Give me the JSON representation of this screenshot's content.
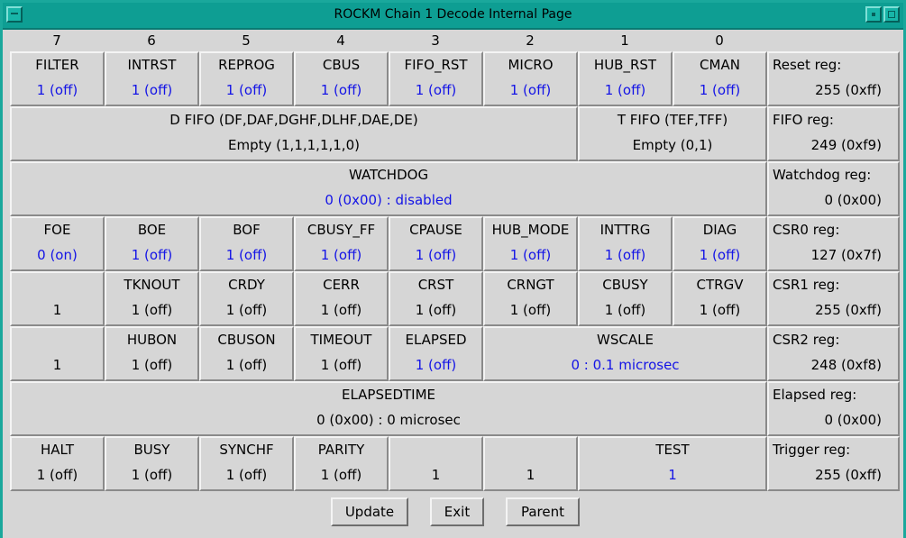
{
  "window": {
    "title": "ROCKM Chain 1 Decode Internal Page"
  },
  "columns": [
    "7",
    "6",
    "5",
    "4",
    "3",
    "2",
    "1",
    "0"
  ],
  "rows": [
    {
      "cells": [
        {
          "label": "FILTER",
          "value": "1 (off)",
          "blue": true
        },
        {
          "label": "INTRST",
          "value": "1 (off)",
          "blue": true
        },
        {
          "label": "REPROG",
          "value": "1 (off)",
          "blue": true
        },
        {
          "label": "CBUS",
          "value": "1 (off)",
          "blue": true
        },
        {
          "label": "FIFO_RST",
          "value": "1 (off)",
          "blue": true
        },
        {
          "label": "MICRO",
          "value": "1 (off)",
          "blue": true
        },
        {
          "label": "HUB_RST",
          "value": "1 (off)",
          "blue": true
        },
        {
          "label": "CMAN",
          "value": "1 (off)",
          "blue": true
        }
      ],
      "reg": {
        "label": "Reset reg:",
        "value": "255 (0xff)"
      }
    },
    {
      "cells": [
        {
          "label": "D FIFO (DF,DAF,DGHF,DLHF,DAE,DE)",
          "value": "Empty (1,1,1,1,1,0)",
          "blue": false,
          "span": 6
        },
        {
          "label": "T FIFO (TEF,TFF)",
          "value": "Empty (0,1)",
          "blue": false,
          "span": 2
        }
      ],
      "reg": {
        "label": "FIFO reg:",
        "value": "249 (0xf9)"
      }
    },
    {
      "cells": [
        {
          "label": "WATCHDOG",
          "value": "0 (0x00) : disabled",
          "blue": true,
          "span": 8
        }
      ],
      "reg": {
        "label": "Watchdog reg:",
        "value": "0 (0x00)"
      }
    },
    {
      "cells": [
        {
          "label": "FOE",
          "value": "0 (on)",
          "blue": true
        },
        {
          "label": "BOE",
          "value": "1 (off)",
          "blue": true
        },
        {
          "label": "BOF",
          "value": "1 (off)",
          "blue": true
        },
        {
          "label": "CBUSY_FF",
          "value": "1 (off)",
          "blue": true
        },
        {
          "label": "CPAUSE",
          "value": "1 (off)",
          "blue": true
        },
        {
          "label": "HUB_MODE",
          "value": "1 (off)",
          "blue": true
        },
        {
          "label": "INTTRG",
          "value": "1 (off)",
          "blue": true
        },
        {
          "label": "DIAG",
          "value": "1 (off)",
          "blue": true
        }
      ],
      "reg": {
        "label": "CSR0 reg:",
        "value": "127 (0x7f)"
      }
    },
    {
      "cells": [
        {
          "label": "",
          "value": "1",
          "blue": false
        },
        {
          "label": "TKNOUT",
          "value": "1 (off)",
          "blue": false
        },
        {
          "label": "CRDY",
          "value": "1 (off)",
          "blue": false
        },
        {
          "label": "CERR",
          "value": "1 (off)",
          "blue": false
        },
        {
          "label": "CRST",
          "value": "1 (off)",
          "blue": false
        },
        {
          "label": "CRNGT",
          "value": "1 (off)",
          "blue": false
        },
        {
          "label": "CBUSY",
          "value": "1 (off)",
          "blue": false
        },
        {
          "label": "CTRGV",
          "value": "1 (off)",
          "blue": false
        }
      ],
      "reg": {
        "label": "CSR1 reg:",
        "value": "255 (0xff)"
      }
    },
    {
      "cells": [
        {
          "label": "",
          "value": "1",
          "blue": false
        },
        {
          "label": "HUBON",
          "value": "1 (off)",
          "blue": false
        },
        {
          "label": "CBUSON",
          "value": "1 (off)",
          "blue": false
        },
        {
          "label": "TIMEOUT",
          "value": "1 (off)",
          "blue": false
        },
        {
          "label": "ELAPSED",
          "value": "1 (off)",
          "blue": true
        },
        {
          "label": "WSCALE",
          "value": "0 : 0.1 microsec",
          "blue": true,
          "span": 3
        }
      ],
      "reg": {
        "label": "CSR2 reg:",
        "value": "248 (0xf8)"
      }
    },
    {
      "cells": [
        {
          "label": "ELAPSEDTIME",
          "value": "0 (0x00) : 0 microsec",
          "blue": false,
          "span": 8
        }
      ],
      "reg": {
        "label": "Elapsed reg:",
        "value": "0 (0x00)"
      }
    },
    {
      "cells": [
        {
          "label": "HALT",
          "value": "1 (off)",
          "blue": false
        },
        {
          "label": "BUSY",
          "value": "1 (off)",
          "blue": false
        },
        {
          "label": "SYNCHF",
          "value": "1 (off)",
          "blue": false
        },
        {
          "label": "PARITY",
          "value": "1 (off)",
          "blue": false
        },
        {
          "label": "",
          "value": "1",
          "blue": false
        },
        {
          "label": "",
          "value": "1",
          "blue": false
        },
        {
          "label": "TEST",
          "value": "1",
          "blue": true,
          "span": 2
        }
      ],
      "reg": {
        "label": "Trigger reg:",
        "value": "255 (0xff)"
      }
    }
  ],
  "buttons": {
    "update": "Update",
    "exit": "Exit",
    "parent": "Parent"
  }
}
